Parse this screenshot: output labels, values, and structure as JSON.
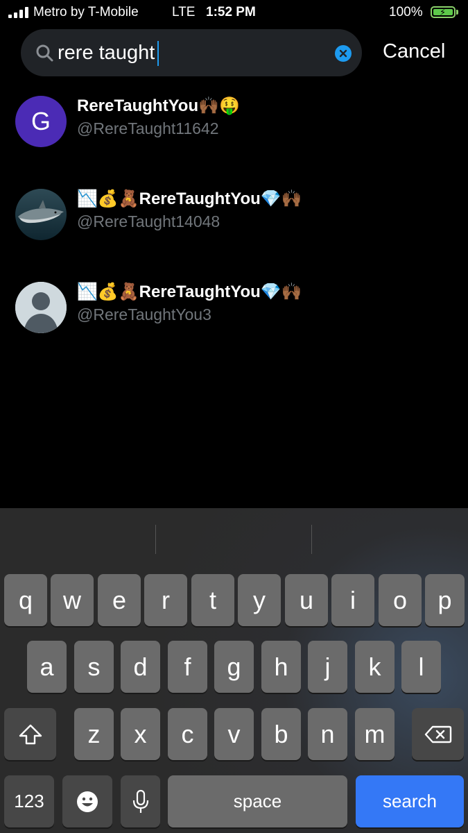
{
  "status_bar": {
    "carrier": "Metro by T-Mobile",
    "network": "LTE",
    "time": "1:52 PM",
    "battery_percent": "100%",
    "battery_level": 1.0,
    "charging": true
  },
  "search": {
    "query": "rere taught",
    "cancel_label": "Cancel",
    "icons": [
      "search-icon",
      "clear-icon"
    ]
  },
  "results": [
    {
      "avatar_letter": "G",
      "avatar_color": "#4b2bb5",
      "display_name": "RereTaughtYou🙌🏾🤑",
      "handle": "@RereTaught11642"
    },
    {
      "avatar_type": "photo",
      "display_name": "📉💰🧸RereTaughtYou💎🙌🏾",
      "handle": "@RereTaught14048"
    },
    {
      "avatar_type": "default",
      "display_name": "📉💰🧸RereTaughtYou💎🙌🏾",
      "handle": "@RereTaughtYou3"
    }
  ],
  "keyboard": {
    "row1": [
      "q",
      "w",
      "e",
      "r",
      "t",
      "y",
      "u",
      "i",
      "o",
      "p"
    ],
    "row2": [
      "a",
      "s",
      "d",
      "f",
      "g",
      "h",
      "j",
      "k",
      "l"
    ],
    "row3": [
      "z",
      "x",
      "c",
      "v",
      "b",
      "n",
      "m"
    ],
    "numbers_label": "123",
    "space_label": "space",
    "search_label": "search",
    "accent_color": "#3478f6"
  }
}
